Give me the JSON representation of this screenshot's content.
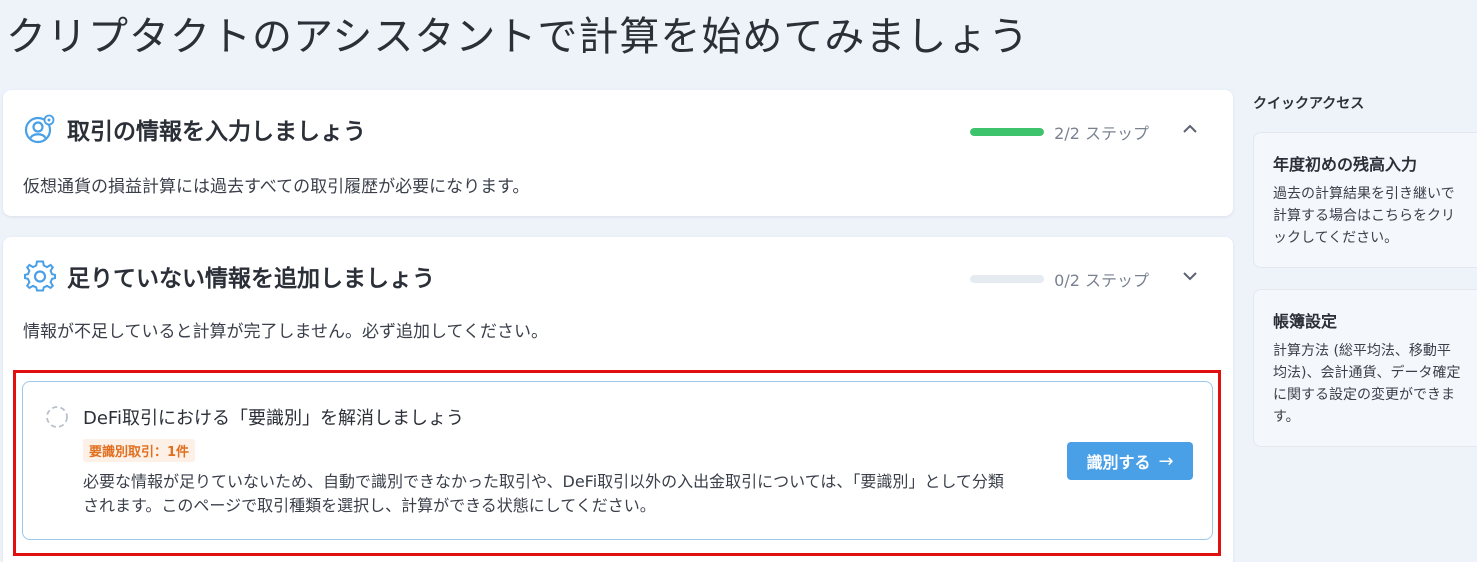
{
  "page": {
    "title": "クリプタクトのアシスタントで計算を始めてみましょう"
  },
  "section1": {
    "title": "取引の情報を入力しましょう",
    "description": "仮想通貨の損益計算には過去すべての取引履歴が必要になります。",
    "progress_text": "2/2 ステップ",
    "progress_fraction": 1.0,
    "expanded": true
  },
  "section2": {
    "title": "足りていない情報を追加しましょう",
    "description": "情報が不足していると計算が完了しません。必ず追加してください。",
    "progress_text": "0/2 ステップ",
    "progress_fraction": 0.0,
    "expanded": false,
    "task": {
      "title": "DeFi取引における「要識別」を解消しましょう",
      "badge": "要識別取引：1件",
      "body": "必要な情報が足りていないため、自動で識別できなかった取引や、DeFi取引以外の入出金取引については、「要識別」として分類されます。このページで取引種類を選択し、計算ができる状態にしてください。",
      "button_label": "識別する",
      "button_arrow": "→"
    }
  },
  "quick_access": {
    "label": "クイックアクセス",
    "items": [
      {
        "title": "年度初めの残高入力",
        "description": "過去の計算結果を引き継いで計算する場合はこちらをクリックしてください。"
      },
      {
        "title": "帳簿設定",
        "description": "計算方法 (総平均法、移動平均法)、会計通貨、データ確定に関する設定の変更ができます。"
      }
    ]
  },
  "colors": {
    "accent": "#4aa0e6",
    "progress_done": "#3cc36b",
    "highlight": "#e10f0f",
    "badge_text": "#e07020"
  },
  "icons": {
    "section1": "user-gear-icon",
    "section2": "gear-icon",
    "task": "pending-circle-icon"
  }
}
